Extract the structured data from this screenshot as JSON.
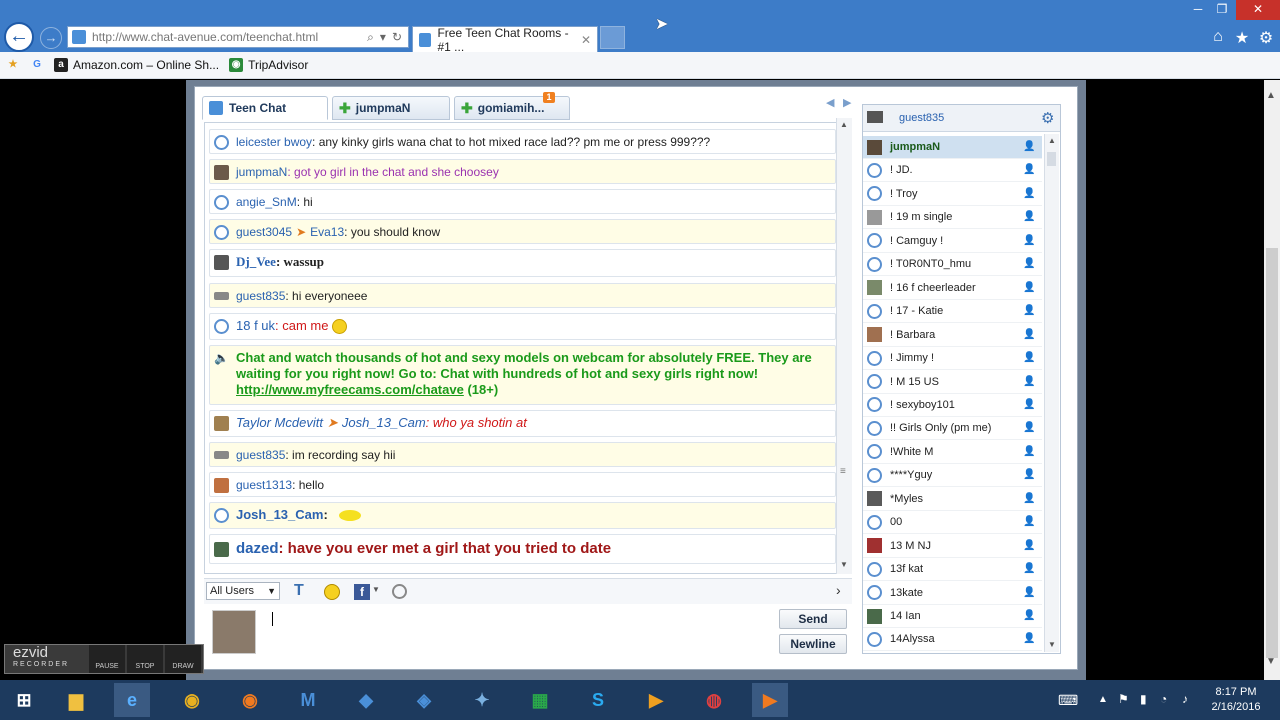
{
  "browser": {
    "url": "http://www.chat-avenue.com/teenchat.html",
    "tab_title": "Free Teen Chat Rooms - #1 ...",
    "favorites": [
      "Amazon.com – Online Sh...",
      "TripAdvisor"
    ]
  },
  "chat": {
    "tabs": [
      {
        "label": "Teen Chat"
      },
      {
        "label": "jumpmaN"
      },
      {
        "label": "gomiamih...",
        "badge": "1"
      }
    ],
    "messages": [
      {
        "user": "leicester bwoy",
        "text": ": any kinky girls wana chat to hot mixed race lad?? pm me or press 999???",
        "color": "#222222"
      },
      {
        "user": "jumpmaN",
        "text": ": got yo girl in the chat and she choosey",
        "color": "#9a32b0"
      },
      {
        "user": "angie_SnM",
        "text": ": hi",
        "color": "#222222"
      },
      {
        "user": "guest3045",
        "to": "Eva13",
        "text": ": you should know",
        "color": "#222222"
      },
      {
        "user": "Dj_Vee",
        "text": ": wassup",
        "color": "#222222"
      },
      {
        "user": "guest835",
        "text": ": hi everyoneee",
        "color": "#222222"
      },
      {
        "user": "18 f uk",
        "text": ": cam me",
        "color": "#d01818"
      },
      {
        "user": "",
        "text": "Chat and watch thousands of hot and sexy models on webcam for absolutely FREE.  They are waiting for you right now! Go to: Chat with hundreds of hot and sexy girls right now!",
        "link": "http://www.myfreecams.com/chatave",
        "suffix": " (18+)",
        "color": "#1a9a1a"
      },
      {
        "user": "Taylor Mcdevitt",
        "to": "Josh_13_Cam",
        "text": ": who ya shotin at",
        "color": "#d01818"
      },
      {
        "user": "guest835",
        "text": ": im recording say hii",
        "color": "#222222"
      },
      {
        "user": "guest1313",
        "text": ": hello",
        "color": "#222222"
      },
      {
        "user": "Josh_13_Cam",
        "text": ":",
        "color": "#222222"
      },
      {
        "user": "dazed",
        "text": ": have you ever met a girl that you tried to date",
        "color": "#a01818"
      }
    ],
    "user_filter": "All Users",
    "send_label": "Send",
    "newline_label": "Newline"
  },
  "userlist": {
    "me": "guest835",
    "users": [
      "jumpmaN",
      "!   JD.",
      "!   Troy",
      "!  19 m single",
      "!  Camguy !",
      "!  T0R0NT0_hmu",
      "! 16 f cheerleader",
      "! 17 - Katie",
      "! Barbara",
      "! Jimmy !",
      "! M 15 US",
      "! sexyboy101",
      "!! Girls Only (pm me)",
      "!White M",
      "****Yguy",
      "*Myles",
      "00",
      "13 M NJ",
      "13f kat",
      "13kate",
      "14 Ian",
      "14Alyssa"
    ]
  },
  "ezvid": {
    "logo": "ezvid",
    "sub": "RECORDER",
    "buttons": [
      "PAUSE",
      "STOP",
      "DRAW"
    ]
  },
  "taskbar": {
    "time": "8:17 PM",
    "date": "2/16/2016"
  }
}
